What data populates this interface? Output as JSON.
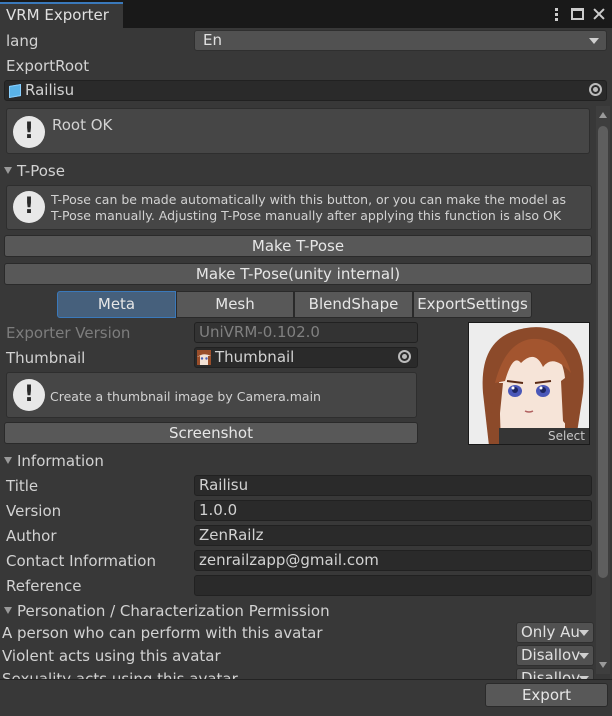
{
  "window": {
    "tab_title": "VRM Exporter"
  },
  "lang": {
    "label": "lang",
    "value": "En"
  },
  "export_root": {
    "label": "ExportRoot",
    "value": "Railisu"
  },
  "root_status": {
    "text": "Root OK"
  },
  "tpose": {
    "header": "T-Pose",
    "help_line1": "T-Pose can be made automatically with this button, or you can make the model as",
    "help_line2": "T-Pose manually. Adjusting T-Pose manually after applying this function is also OK",
    "make_button": "Make T-Pose",
    "make_internal_button": "Make T-Pose(unity internal)"
  },
  "tabs": [
    {
      "label": "Meta",
      "active": true
    },
    {
      "label": "Mesh",
      "active": false
    },
    {
      "label": "BlendShape",
      "active": false
    },
    {
      "label": "ExportSettings",
      "active": false
    }
  ],
  "meta": {
    "exporter_version_label": "Exporter Version",
    "exporter_version_value": "UniVRM-0.102.0",
    "thumbnail_label": "Thumbnail",
    "thumbnail_value": "Thumbnail",
    "thumbnail_help": "Create a thumbnail image by Camera.main",
    "screenshot_button": "Screenshot",
    "thumbnail_select": "Select"
  },
  "information": {
    "header": "Information",
    "fields": [
      {
        "label": "Title",
        "value": "Railisu"
      },
      {
        "label": "Version",
        "value": "1.0.0"
      },
      {
        "label": "Author",
        "value": "ZenRailz"
      },
      {
        "label": "Contact Information",
        "value": "zenrailzapp@gmail.com"
      },
      {
        "label": "Reference",
        "value": ""
      }
    ]
  },
  "permission": {
    "header": "Personation / Characterization Permission",
    "rows": [
      {
        "label": "A person who can perform with this avatar",
        "value": "Only Au"
      },
      {
        "label": "Violent acts using this avatar",
        "value": "Disallov"
      },
      {
        "label": "Sexuality acts using this avatar",
        "value": "Disallov"
      }
    ]
  },
  "footer": {
    "export_button": "Export"
  },
  "colors": {
    "background": "#383838",
    "accent": "#3a79bb",
    "field": "#2a2a2a"
  }
}
